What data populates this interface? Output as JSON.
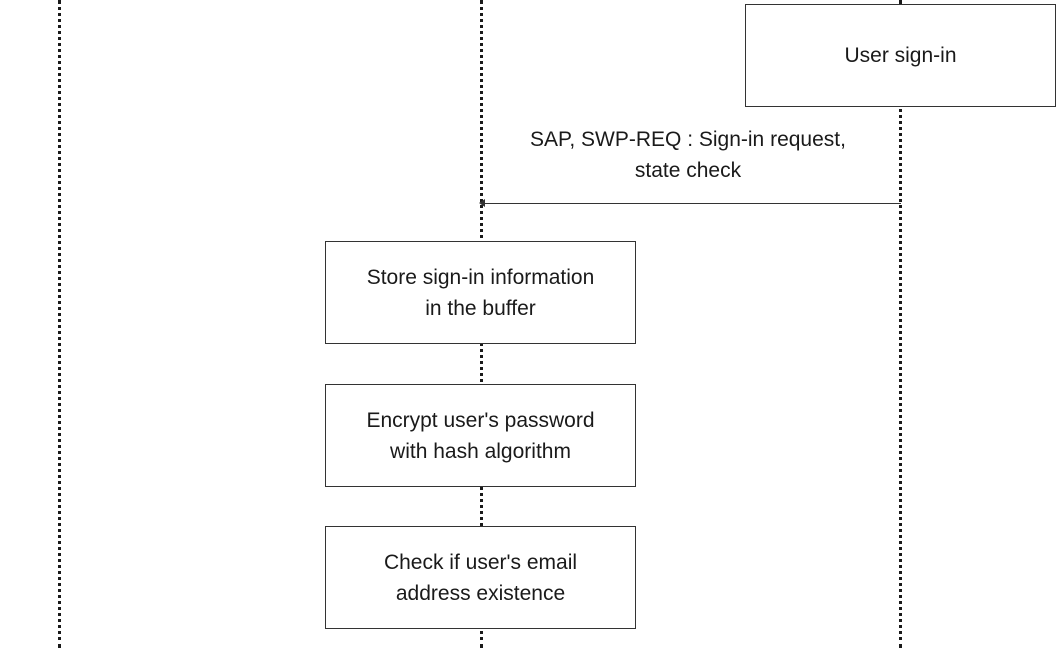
{
  "diagram": {
    "activation_box": {
      "label": "User sign-in"
    },
    "message": {
      "label_line1": "SAP, SWP-REQ : Sign-in request,",
      "label_line2": "state check"
    },
    "steps": [
      {
        "line1": "Store sign-in information",
        "line2": "in the buffer"
      },
      {
        "line1": "Encrypt user's password",
        "line2": "with hash algorithm"
      },
      {
        "line1": "Check if user's email",
        "line2": "address existence"
      }
    ]
  }
}
